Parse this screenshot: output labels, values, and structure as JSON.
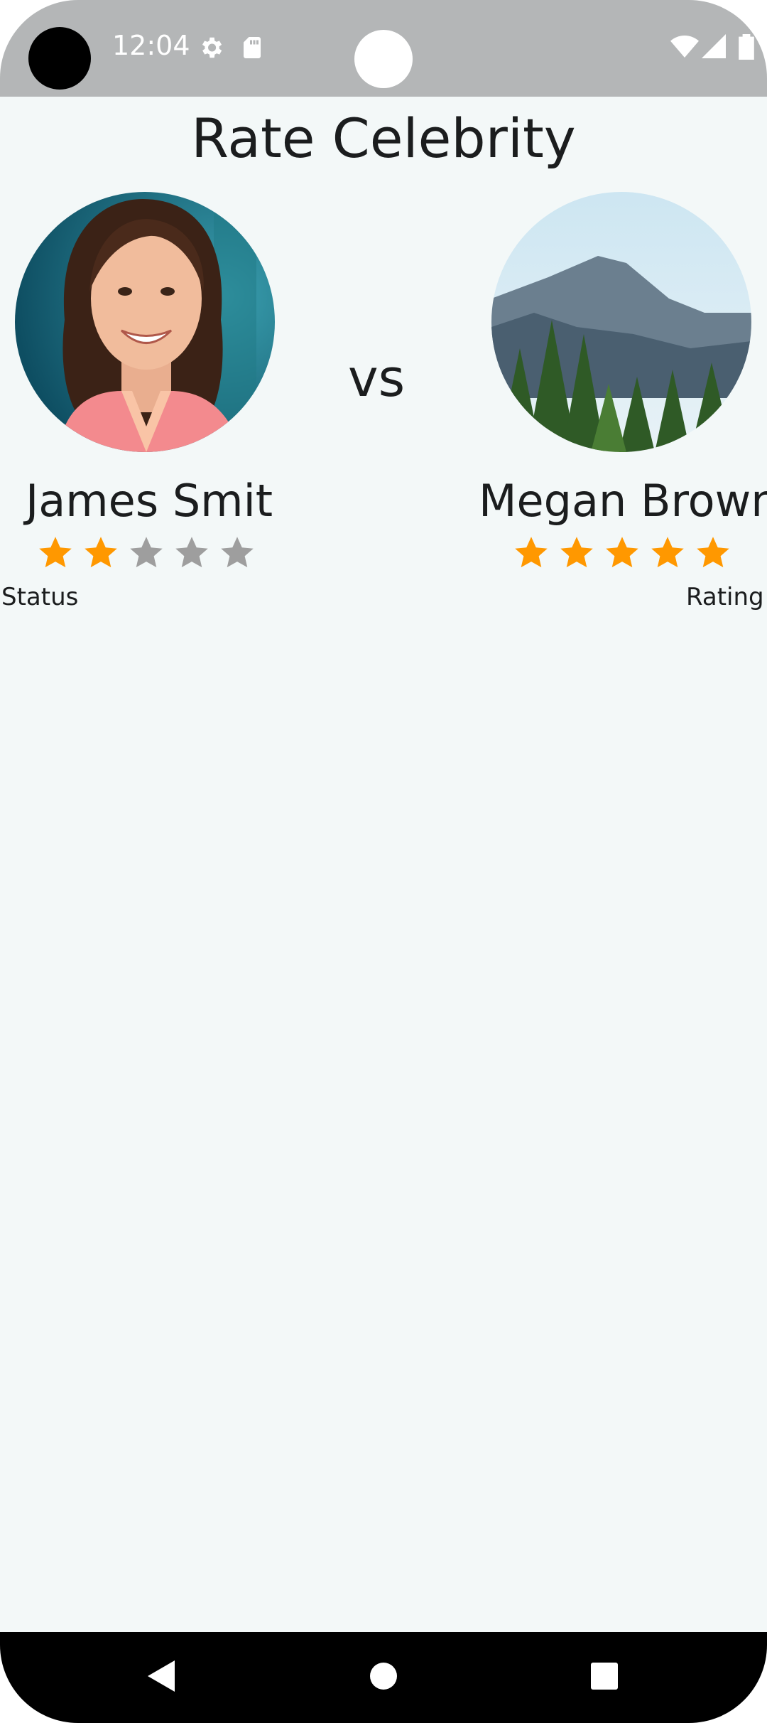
{
  "status_bar": {
    "time": "12:04",
    "icons": [
      "gear-icon",
      "sd-card-icon",
      "wifi-icon",
      "signal-icon",
      "battery-icon"
    ]
  },
  "page": {
    "title": "Rate Celebrity"
  },
  "comparison": {
    "vs_label": "vs",
    "left": {
      "name": "James Smit",
      "rating": 2,
      "max_rating": 5,
      "caption": "Status"
    },
    "right": {
      "name": "Megan Brown",
      "rating": 5,
      "max_rating": 5,
      "caption": "Rating"
    }
  },
  "colors": {
    "star_filled": "#ff9800",
    "star_empty": "#9e9e9e",
    "background": "#f3f8f8"
  },
  "nav_bar": {
    "buttons": [
      "back-icon",
      "home-icon",
      "recents-icon"
    ]
  }
}
